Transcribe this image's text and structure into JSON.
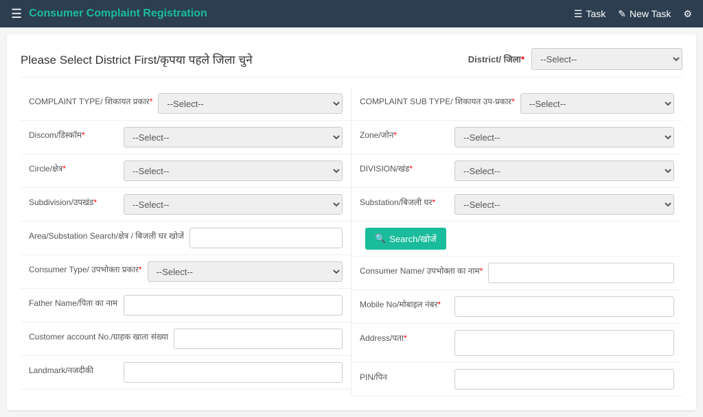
{
  "header": {
    "menu_icon": "☰",
    "title": "Consumer Complaint Registration",
    "nav_items": [
      {
        "icon": "☰",
        "label": "Task"
      },
      {
        "icon": "✎",
        "label": "New Task"
      },
      {
        "icon": "⚙",
        "label": ""
      }
    ]
  },
  "page": {
    "heading": "Please Select District First/कृपया पहले जिला चुने",
    "district_label": "District/ जिला",
    "district_required": "*",
    "district_placeholder": "--Select--"
  },
  "fields": {
    "complaint_type_label": "COMPLAINT TYPE/ शिकायत प्रकार",
    "complaint_sub_type_label": "COMPLAINT SUB TYPE/ शिकायत उप-प्रकार",
    "discom_label": "Discom/डिस्कॉम",
    "zone_label": "Zone/जोन",
    "circle_label": "Circle/क्षेत्र",
    "division_label": "DIVISION/खंड",
    "subdivision_label": "Subdivision/उपखंड",
    "substation_label": "Substation/बिजली घर",
    "area_label": "Area/Substation Search/क्षेत्र / बिजली घर खोजें",
    "consumer_type_label": "Consumer Type/ उपभोक्ता प्रकार",
    "consumer_name_label": "Consumer Name/ उपभोक्ता का नाम",
    "father_name_label": "Father Name/पिता का नाम",
    "mobile_label": "Mobile No/मोबाइल नंबर",
    "customer_account_label": "Customer account No./ग्राहक खाता संख्या",
    "address_label": "Address/पता",
    "landmark_label": "Landmark/नजदीकी",
    "pin_label": "PIN/पिन",
    "select_placeholder": "--Select--",
    "search_btn": "Search/खोजें",
    "required_star": "*"
  }
}
